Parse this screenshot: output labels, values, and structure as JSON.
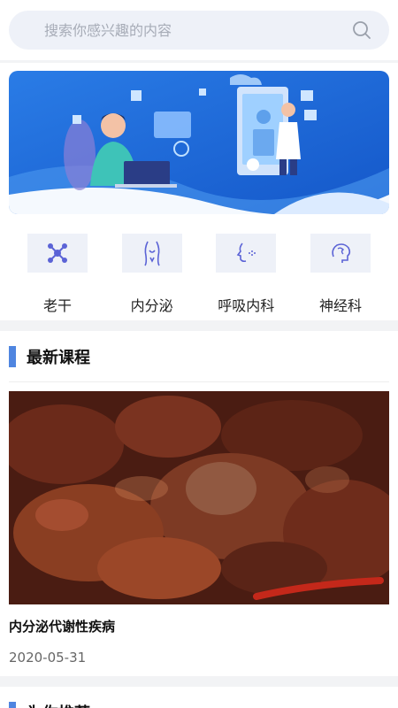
{
  "search": {
    "placeholder": "搜索你感兴趣的内容"
  },
  "categories": [
    {
      "label": "老干",
      "icon": "molecule-icon"
    },
    {
      "label": "内分泌",
      "icon": "body-icon"
    },
    {
      "label": "呼吸内科",
      "icon": "face-breath-icon"
    },
    {
      "label": "神经科",
      "icon": "brain-icon"
    }
  ],
  "latest": {
    "title": "最新课程",
    "course": {
      "title": "内分泌代谢性疾病",
      "date": "2020-05-31"
    }
  },
  "recommend": {
    "title": "为你推荐"
  },
  "colors": {
    "accent": "#4f85e0",
    "banner": "#1a63d6"
  }
}
